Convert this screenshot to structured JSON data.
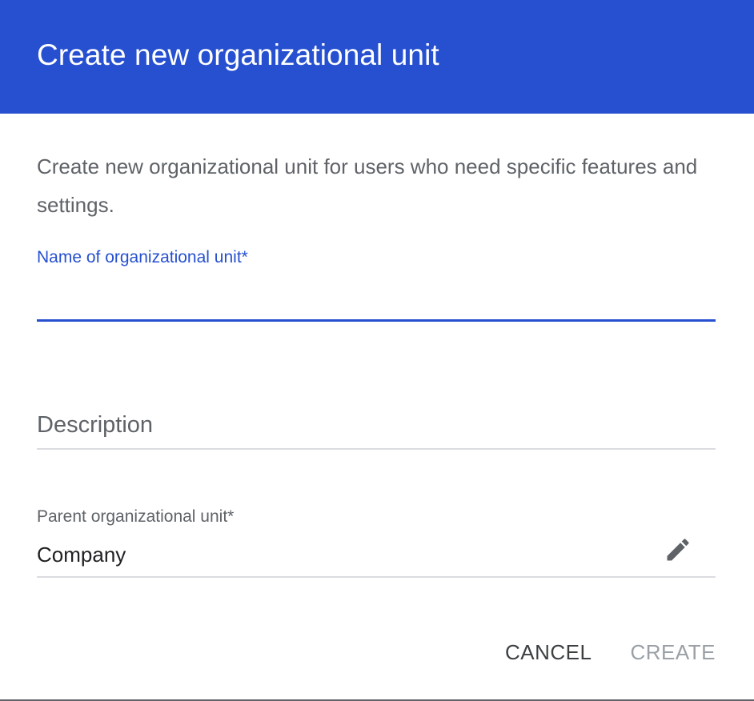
{
  "dialog": {
    "title": "Create new organizational unit",
    "description": "Create new organizational unit for users who need specific features and settings."
  },
  "fields": {
    "name": {
      "label": "Name of organizational unit*",
      "value": ""
    },
    "description": {
      "placeholder": "Description",
      "value": ""
    },
    "parent": {
      "label": "Parent organizational unit*",
      "value": "Company",
      "icon": "pencil-edit-icon"
    }
  },
  "actions": {
    "cancel_label": "CANCEL",
    "create_label": "CREATE"
  },
  "colors": {
    "header_bg": "#2650d0",
    "accent": "#2650d0",
    "disabled_text": "#9aa0a6"
  }
}
